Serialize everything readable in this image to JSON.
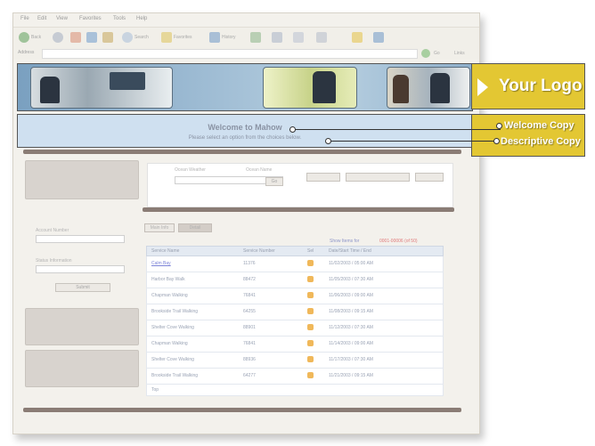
{
  "browser": {
    "menu": [
      "File",
      "Edit",
      "View",
      "Favorites",
      "Tools",
      "Help"
    ],
    "toolbar": [
      "Back",
      "Search",
      "Favorites",
      "History"
    ],
    "address_label": "Address",
    "go_label": "Go",
    "links_label": "Links"
  },
  "banner": {
    "logo_text": "Your Logo"
  },
  "welcome": {
    "title": "Welcome to Mahow",
    "description": "Please select an option from the choices below."
  },
  "callouts": {
    "welcome_copy": "Welcome Copy",
    "descriptive_copy": "Descriptive Copy"
  },
  "search": {
    "radio1": "Ocean Weather",
    "radio2": "Ocean Name",
    "go_button": "Go"
  },
  "sidebar": {
    "field1_label": "Account Number",
    "field2_label": "Status Information",
    "button": "Submit"
  },
  "tabs": [
    "Main Info",
    "Detail"
  ],
  "table": {
    "legend_left": "Show Items for",
    "legend_right": "0001-00006 (of 50)",
    "headers": [
      "Service Name",
      "Service Number",
      "Sel",
      "Date/Start Time / End"
    ],
    "rows": [
      {
        "name": "Calm Bay",
        "number": "11376",
        "date": "11/02/2003 / 05:00 AM"
      },
      {
        "name": "Harbor Bay Walk",
        "number": "88472",
        "date": "11/05/2003 / 07:30 AM"
      },
      {
        "name": "Chapman Walking",
        "number": "76841",
        "date": "11/06/2003 / 09:00 AM"
      },
      {
        "name": "Brookside Trail Walking",
        "number": "64255",
        "date": "11/08/2003 / 09:15 AM"
      },
      {
        "name": "Shelter Cove Walking",
        "number": "88901",
        "date": "11/12/2003 / 07:30 AM"
      },
      {
        "name": "Chapman Walking",
        "number": "76841",
        "date": "11/14/2003 / 09:00 AM"
      },
      {
        "name": "Shelter Cove Walking",
        "number": "88936",
        "date": "11/17/2003 / 07:30 AM"
      },
      {
        "name": "Brookside Trail Walking",
        "number": "64277",
        "date": "11/21/2003 / 09:15 AM"
      }
    ],
    "footer": "Top"
  },
  "colors": {
    "banner_blue": "#9dbbd3",
    "welcome_bg": "#cfe0f0",
    "callout_yellow": "#e3c733",
    "divider": "#6f5f58"
  },
  "icons": [
    "back-icon",
    "forward-icon",
    "stop-icon",
    "refresh-icon",
    "home-icon",
    "search-icon",
    "favorites-icon",
    "history-icon",
    "mail-icon",
    "print-icon",
    "edit-icon",
    "logo-arrow-icon"
  ]
}
